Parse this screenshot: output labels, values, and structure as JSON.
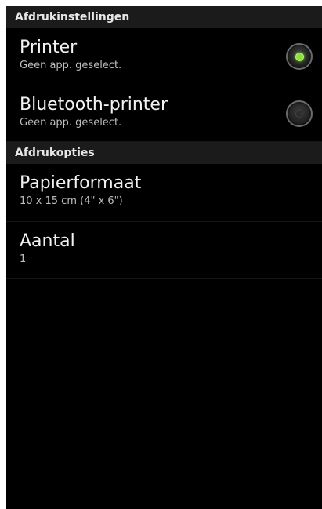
{
  "sections": {
    "print_settings": {
      "title": "Afdrukinstellingen",
      "printer": {
        "title": "Printer",
        "subtitle": "Geen app. geselect.",
        "selected": true
      },
      "bluetooth_printer": {
        "title": "Bluetooth-printer",
        "subtitle": "Geen app. geselect.",
        "selected": false
      }
    },
    "print_options": {
      "title": "Afdrukopties",
      "paper_size": {
        "title": "Papierformaat",
        "value": "10 x 15 cm (4\" x 6\")"
      },
      "quantity": {
        "title": "Aantal",
        "value": "1"
      }
    }
  },
  "colors": {
    "background": "#000000",
    "header_background": "#1b1b1b",
    "radio_active": "#8fe03a"
  },
  "icons": {
    "printer_radio": "radio-button-selected-icon",
    "bluetooth_radio": "radio-button-unselected-icon"
  }
}
